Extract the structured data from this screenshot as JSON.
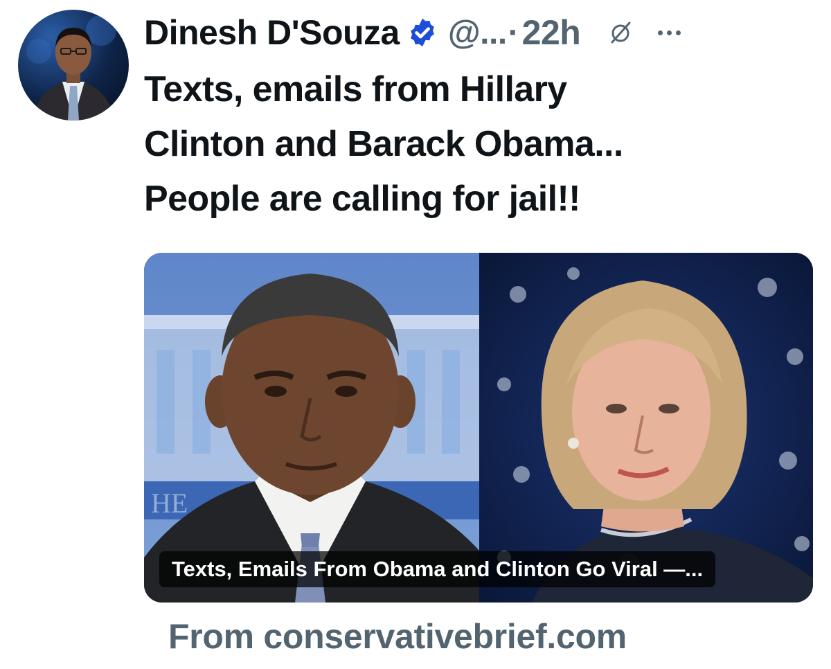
{
  "author": {
    "name": "Dinesh D'Souza",
    "handle": "@...",
    "separator": "·",
    "time": "22h",
    "verified_color": "#1d4ed8"
  },
  "icons": {
    "verified": "verified-badge-icon",
    "grok": "grok-icon",
    "more": "more-options-icon"
  },
  "tweet": {
    "lines": [
      "Texts, emails from Hillary",
      "Clinton and Barack Obama...",
      "People are calling for jail!!"
    ]
  },
  "card": {
    "caption": "Texts, Emails From Obama and Clinton Go Viral —...",
    "left_image": "photo of Barack Obama in front of White House backdrop",
    "right_image": "photo of Hillary Clinton in front of starred blue backdrop"
  },
  "source_text": "From conservativebrief.com",
  "colors": {
    "text_primary": "#0f1419",
    "text_secondary": "#536471",
    "caption_bg": "#000000"
  }
}
